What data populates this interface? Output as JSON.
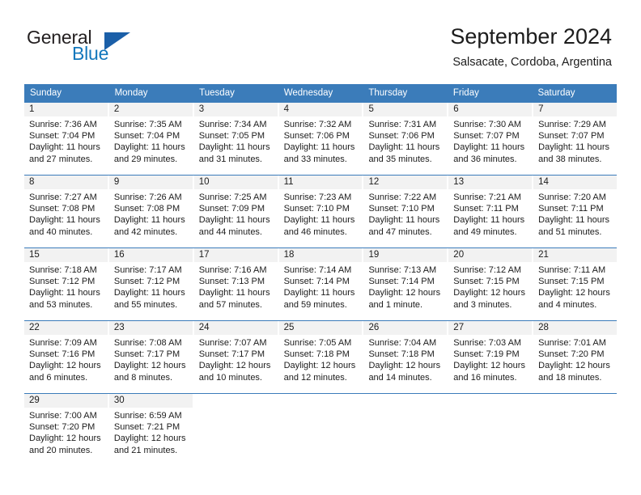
{
  "logo": {
    "word_one": "General",
    "word_two": "Blue",
    "triangle_color": "#1b5fa8",
    "blue_color": "#1277bc"
  },
  "header": {
    "title": "September 2024",
    "subtitle": "Salsacate, Cordoba, Argentina"
  },
  "theme": {
    "header_blue": "#3b7cba",
    "daynum_band": "#f2f2f2",
    "text": "#1c1c1c"
  },
  "weekdays": [
    "Sunday",
    "Monday",
    "Tuesday",
    "Wednesday",
    "Thursday",
    "Friday",
    "Saturday"
  ],
  "weeks": [
    [
      {
        "day": "1",
        "sunrise": "Sunrise: 7:36 AM",
        "sunset": "Sunset: 7:04 PM",
        "daylight_1": "Daylight: 11 hours",
        "daylight_2": "and 27 minutes."
      },
      {
        "day": "2",
        "sunrise": "Sunrise: 7:35 AM",
        "sunset": "Sunset: 7:04 PM",
        "daylight_1": "Daylight: 11 hours",
        "daylight_2": "and 29 minutes."
      },
      {
        "day": "3",
        "sunrise": "Sunrise: 7:34 AM",
        "sunset": "Sunset: 7:05 PM",
        "daylight_1": "Daylight: 11 hours",
        "daylight_2": "and 31 minutes."
      },
      {
        "day": "4",
        "sunrise": "Sunrise: 7:32 AM",
        "sunset": "Sunset: 7:06 PM",
        "daylight_1": "Daylight: 11 hours",
        "daylight_2": "and 33 minutes."
      },
      {
        "day": "5",
        "sunrise": "Sunrise: 7:31 AM",
        "sunset": "Sunset: 7:06 PM",
        "daylight_1": "Daylight: 11 hours",
        "daylight_2": "and 35 minutes."
      },
      {
        "day": "6",
        "sunrise": "Sunrise: 7:30 AM",
        "sunset": "Sunset: 7:07 PM",
        "daylight_1": "Daylight: 11 hours",
        "daylight_2": "and 36 minutes."
      },
      {
        "day": "7",
        "sunrise": "Sunrise: 7:29 AM",
        "sunset": "Sunset: 7:07 PM",
        "daylight_1": "Daylight: 11 hours",
        "daylight_2": "and 38 minutes."
      }
    ],
    [
      {
        "day": "8",
        "sunrise": "Sunrise: 7:27 AM",
        "sunset": "Sunset: 7:08 PM",
        "daylight_1": "Daylight: 11 hours",
        "daylight_2": "and 40 minutes."
      },
      {
        "day": "9",
        "sunrise": "Sunrise: 7:26 AM",
        "sunset": "Sunset: 7:08 PM",
        "daylight_1": "Daylight: 11 hours",
        "daylight_2": "and 42 minutes."
      },
      {
        "day": "10",
        "sunrise": "Sunrise: 7:25 AM",
        "sunset": "Sunset: 7:09 PM",
        "daylight_1": "Daylight: 11 hours",
        "daylight_2": "and 44 minutes."
      },
      {
        "day": "11",
        "sunrise": "Sunrise: 7:23 AM",
        "sunset": "Sunset: 7:10 PM",
        "daylight_1": "Daylight: 11 hours",
        "daylight_2": "and 46 minutes."
      },
      {
        "day": "12",
        "sunrise": "Sunrise: 7:22 AM",
        "sunset": "Sunset: 7:10 PM",
        "daylight_1": "Daylight: 11 hours",
        "daylight_2": "and 47 minutes."
      },
      {
        "day": "13",
        "sunrise": "Sunrise: 7:21 AM",
        "sunset": "Sunset: 7:11 PM",
        "daylight_1": "Daylight: 11 hours",
        "daylight_2": "and 49 minutes."
      },
      {
        "day": "14",
        "sunrise": "Sunrise: 7:20 AM",
        "sunset": "Sunset: 7:11 PM",
        "daylight_1": "Daylight: 11 hours",
        "daylight_2": "and 51 minutes."
      }
    ],
    [
      {
        "day": "15",
        "sunrise": "Sunrise: 7:18 AM",
        "sunset": "Sunset: 7:12 PM",
        "daylight_1": "Daylight: 11 hours",
        "daylight_2": "and 53 minutes."
      },
      {
        "day": "16",
        "sunrise": "Sunrise: 7:17 AM",
        "sunset": "Sunset: 7:12 PM",
        "daylight_1": "Daylight: 11 hours",
        "daylight_2": "and 55 minutes."
      },
      {
        "day": "17",
        "sunrise": "Sunrise: 7:16 AM",
        "sunset": "Sunset: 7:13 PM",
        "daylight_1": "Daylight: 11 hours",
        "daylight_2": "and 57 minutes."
      },
      {
        "day": "18",
        "sunrise": "Sunrise: 7:14 AM",
        "sunset": "Sunset: 7:14 PM",
        "daylight_1": "Daylight: 11 hours",
        "daylight_2": "and 59 minutes."
      },
      {
        "day": "19",
        "sunrise": "Sunrise: 7:13 AM",
        "sunset": "Sunset: 7:14 PM",
        "daylight_1": "Daylight: 12 hours",
        "daylight_2": "and 1 minute."
      },
      {
        "day": "20",
        "sunrise": "Sunrise: 7:12 AM",
        "sunset": "Sunset: 7:15 PM",
        "daylight_1": "Daylight: 12 hours",
        "daylight_2": "and 3 minutes."
      },
      {
        "day": "21",
        "sunrise": "Sunrise: 7:11 AM",
        "sunset": "Sunset: 7:15 PM",
        "daylight_1": "Daylight: 12 hours",
        "daylight_2": "and 4 minutes."
      }
    ],
    [
      {
        "day": "22",
        "sunrise": "Sunrise: 7:09 AM",
        "sunset": "Sunset: 7:16 PM",
        "daylight_1": "Daylight: 12 hours",
        "daylight_2": "and 6 minutes."
      },
      {
        "day": "23",
        "sunrise": "Sunrise: 7:08 AM",
        "sunset": "Sunset: 7:17 PM",
        "daylight_1": "Daylight: 12 hours",
        "daylight_2": "and 8 minutes."
      },
      {
        "day": "24",
        "sunrise": "Sunrise: 7:07 AM",
        "sunset": "Sunset: 7:17 PM",
        "daylight_1": "Daylight: 12 hours",
        "daylight_2": "and 10 minutes."
      },
      {
        "day": "25",
        "sunrise": "Sunrise: 7:05 AM",
        "sunset": "Sunset: 7:18 PM",
        "daylight_1": "Daylight: 12 hours",
        "daylight_2": "and 12 minutes."
      },
      {
        "day": "26",
        "sunrise": "Sunrise: 7:04 AM",
        "sunset": "Sunset: 7:18 PM",
        "daylight_1": "Daylight: 12 hours",
        "daylight_2": "and 14 minutes."
      },
      {
        "day": "27",
        "sunrise": "Sunrise: 7:03 AM",
        "sunset": "Sunset: 7:19 PM",
        "daylight_1": "Daylight: 12 hours",
        "daylight_2": "and 16 minutes."
      },
      {
        "day": "28",
        "sunrise": "Sunrise: 7:01 AM",
        "sunset": "Sunset: 7:20 PM",
        "daylight_1": "Daylight: 12 hours",
        "daylight_2": "and 18 minutes."
      }
    ],
    [
      {
        "day": "29",
        "sunrise": "Sunrise: 7:00 AM",
        "sunset": "Sunset: 7:20 PM",
        "daylight_1": "Daylight: 12 hours",
        "daylight_2": "and 20 minutes."
      },
      {
        "day": "30",
        "sunrise": "Sunrise: 6:59 AM",
        "sunset": "Sunset: 7:21 PM",
        "daylight_1": "Daylight: 12 hours",
        "daylight_2": "and 21 minutes."
      },
      {
        "day": "",
        "sunrise": "",
        "sunset": "",
        "daylight_1": "",
        "daylight_2": ""
      },
      {
        "day": "",
        "sunrise": "",
        "sunset": "",
        "daylight_1": "",
        "daylight_2": ""
      },
      {
        "day": "",
        "sunrise": "",
        "sunset": "",
        "daylight_1": "",
        "daylight_2": ""
      },
      {
        "day": "",
        "sunrise": "",
        "sunset": "",
        "daylight_1": "",
        "daylight_2": ""
      },
      {
        "day": "",
        "sunrise": "",
        "sunset": "",
        "daylight_1": "",
        "daylight_2": ""
      }
    ]
  ]
}
